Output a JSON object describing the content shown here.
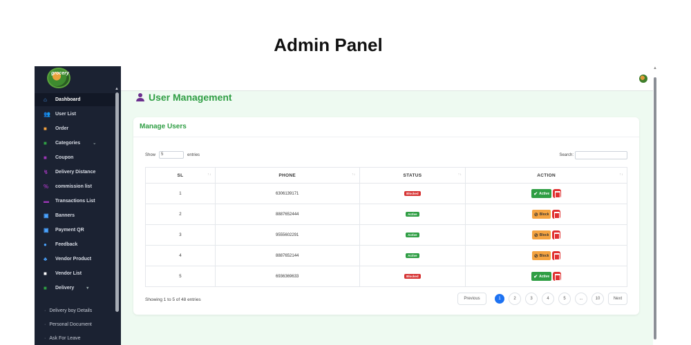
{
  "page_title": "Admin Panel",
  "logo_text": "grocery",
  "sidebar": {
    "items": [
      {
        "label": "Dashboard",
        "icon": "home-icon",
        "color": "#4aa3ff",
        "active": true
      },
      {
        "label": "User List",
        "icon": "users-icon",
        "color": "#4aa3ff"
      },
      {
        "label": "Order",
        "icon": "bag-icon",
        "color": "#f4a340"
      },
      {
        "label": "Categories",
        "icon": "folder-icon",
        "color": "#2f9e44",
        "chevron": "⌄"
      },
      {
        "label": "Coupon",
        "icon": "ticket-icon",
        "color": "#9c36b5"
      },
      {
        "label": "Delivery Distance",
        "icon": "route-icon",
        "color": "#9c36b5"
      },
      {
        "label": "commission list",
        "icon": "percent-icon",
        "color": "#9c36b5"
      },
      {
        "label": "Transactions List",
        "icon": "card-icon",
        "color": "#9c36b5"
      },
      {
        "label": "Banners",
        "icon": "image-icon",
        "color": "#4aa3ff"
      },
      {
        "label": "Payment QR",
        "icon": "image-icon",
        "color": "#4aa3ff"
      },
      {
        "label": "Feedback",
        "icon": "chat-icon",
        "color": "#4aa3ff"
      },
      {
        "label": "Vendor Product",
        "icon": "sitemap-icon",
        "color": "#4aa3ff"
      },
      {
        "label": "Vendor List",
        "icon": "drawer-icon",
        "color": "#ffffff"
      },
      {
        "label": "Delivery",
        "icon": "truck-icon",
        "color": "#2f9e44",
        "chevron": "▾"
      }
    ],
    "sub_items": [
      "Delivery boy Details",
      "Personal Document",
      "Ask For Leave"
    ]
  },
  "main": {
    "section_title": "User Management",
    "card_title": "Manage Users",
    "show_label": "Show",
    "entries_value": "5",
    "entries_label": "entries",
    "search_label": "Search:",
    "columns": [
      "SL",
      "PHONE",
      "STATUS",
      "ACTION"
    ],
    "sort_glyph": "↑↓",
    "rows": [
      {
        "sl": "1",
        "phone": "6306139171",
        "status": "Blocked",
        "action": "Active"
      },
      {
        "sl": "2",
        "phone": "8887652444",
        "status": "Active",
        "action": "Block"
      },
      {
        "sl": "3",
        "phone": "9555602291",
        "status": "Active",
        "action": "Block"
      },
      {
        "sl": "4",
        "phone": "8887652144",
        "status": "Active",
        "action": "Block"
      },
      {
        "sl": "5",
        "phone": "6936369633",
        "status": "Blocked",
        "action": "Active"
      }
    ],
    "info_text": "Showing 1 to 5 of 48 entries",
    "pagination": {
      "previous": "Previous",
      "pages": [
        "1",
        "2",
        "3",
        "4",
        "5",
        "...",
        "10"
      ],
      "current": "1",
      "next": "Next"
    }
  }
}
